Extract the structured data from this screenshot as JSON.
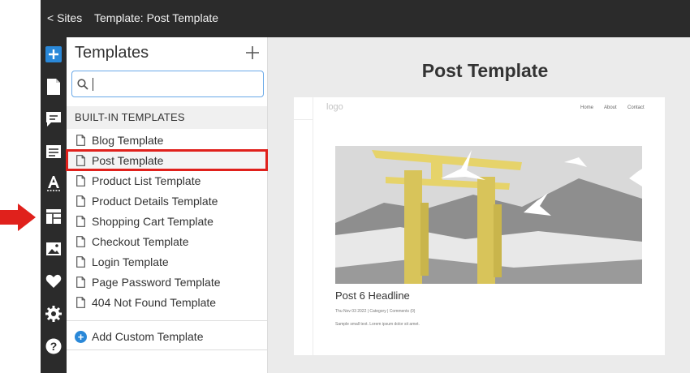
{
  "topbar": {
    "back_label": "< Sites",
    "title": "Template: Post Template"
  },
  "rail": {
    "icons": [
      "add-icon",
      "page-icon",
      "comment-icon",
      "form-icon",
      "text-style-icon",
      "templates-icon",
      "image-icon",
      "heart-icon",
      "settings-icon",
      "help-icon"
    ],
    "active": "templates-icon",
    "accent": "#2a88d8"
  },
  "panel": {
    "title": "Templates",
    "search_value": "",
    "section_heading": "BUILT-IN TEMPLATES",
    "templates": [
      "Blog Template",
      "Post Template",
      "Product List Template",
      "Product Details Template",
      "Shopping Cart Template",
      "Checkout Template",
      "Login Template",
      "Page Password Template",
      "404 Not Found Template"
    ],
    "selected": "Post Template",
    "add_custom_label": "Add Custom Template"
  },
  "preview": {
    "title": "Post Template",
    "logo": "logo",
    "nav": [
      "Home",
      "About",
      "Contact"
    ],
    "headline": "Post 6 Headline",
    "meta": "Thu Nov 03 2022  |  Category  |  Comments (0)",
    "body": "Sample small text. Lorem ipsum dolor sit amet."
  },
  "colors": {
    "highlight": "#e0211c",
    "dark": "#2b2b2b",
    "torii": "#e6d36a"
  }
}
